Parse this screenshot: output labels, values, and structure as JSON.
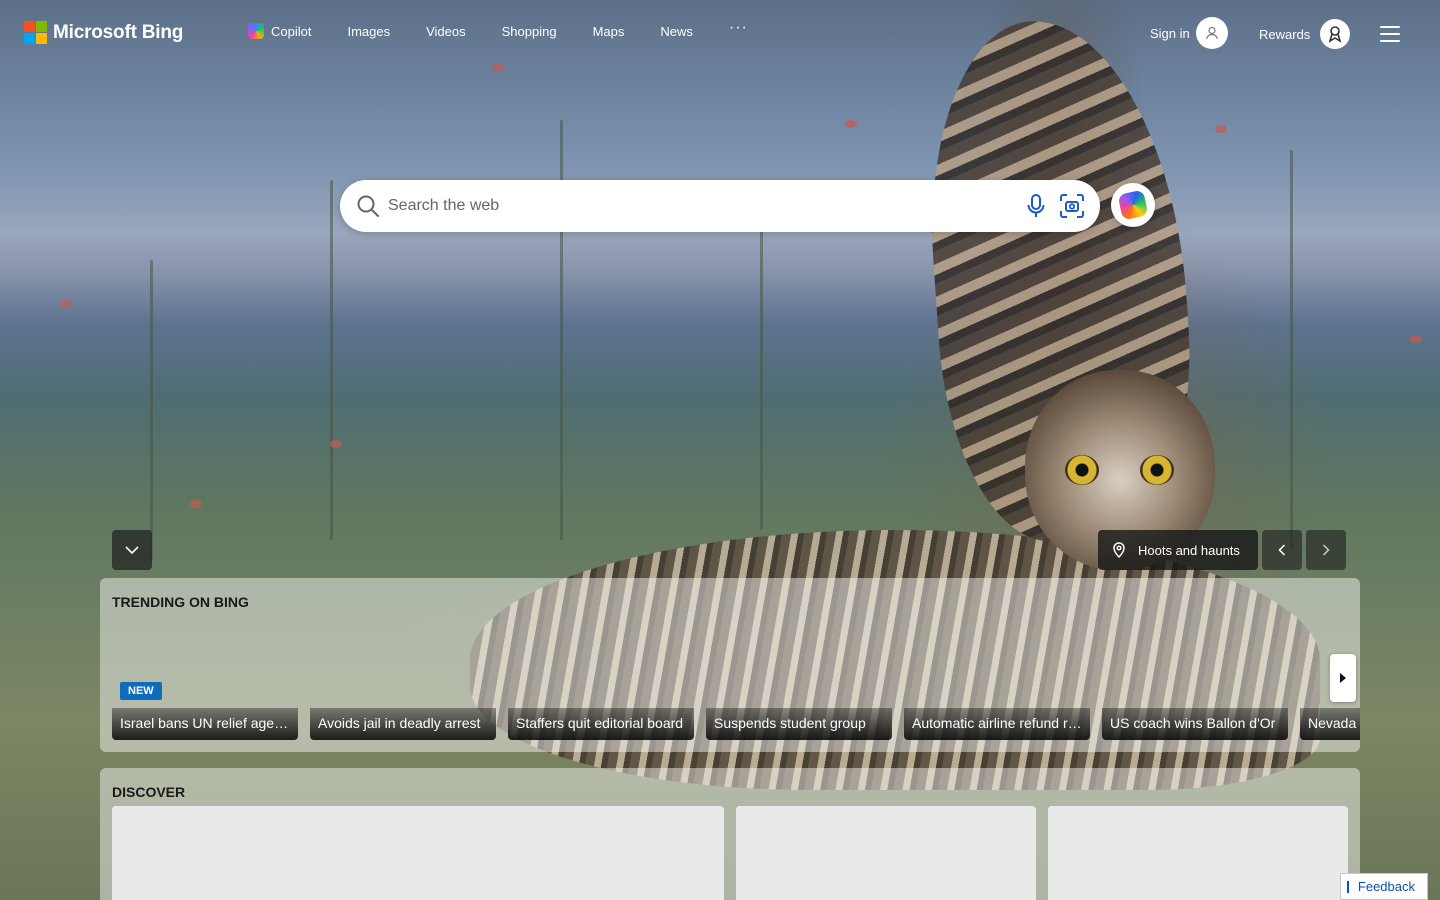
{
  "header": {
    "brand": "Microsoft Bing",
    "nav": [
      {
        "label": "Copilot",
        "icon": "copilot-icon"
      },
      {
        "label": "Images"
      },
      {
        "label": "Videos"
      },
      {
        "label": "Shopping"
      },
      {
        "label": "Maps"
      },
      {
        "label": "News"
      }
    ],
    "more": "···",
    "sign_in": "Sign in",
    "rewards": "Rewards"
  },
  "search": {
    "placeholder": "Search the web"
  },
  "image": {
    "location_label": "Hoots and haunts"
  },
  "trending": {
    "title": "TRENDING ON BING",
    "new_badge": "NEW",
    "items": [
      {
        "label": "Israel bans UN relief agency"
      },
      {
        "label": "Avoids jail in deadly arrest"
      },
      {
        "label": "Staffers quit editorial board"
      },
      {
        "label": "Suspends student group"
      },
      {
        "label": "Automatic airline refund rule"
      },
      {
        "label": "US coach wins Ballon d'Or"
      },
      {
        "label": "Nevada"
      }
    ]
  },
  "discover": {
    "title": "DISCOVER"
  },
  "feedback": "Feedback",
  "colors": {
    "accent": "#0f6cbd",
    "feedback_text": "#0d4fb3"
  }
}
